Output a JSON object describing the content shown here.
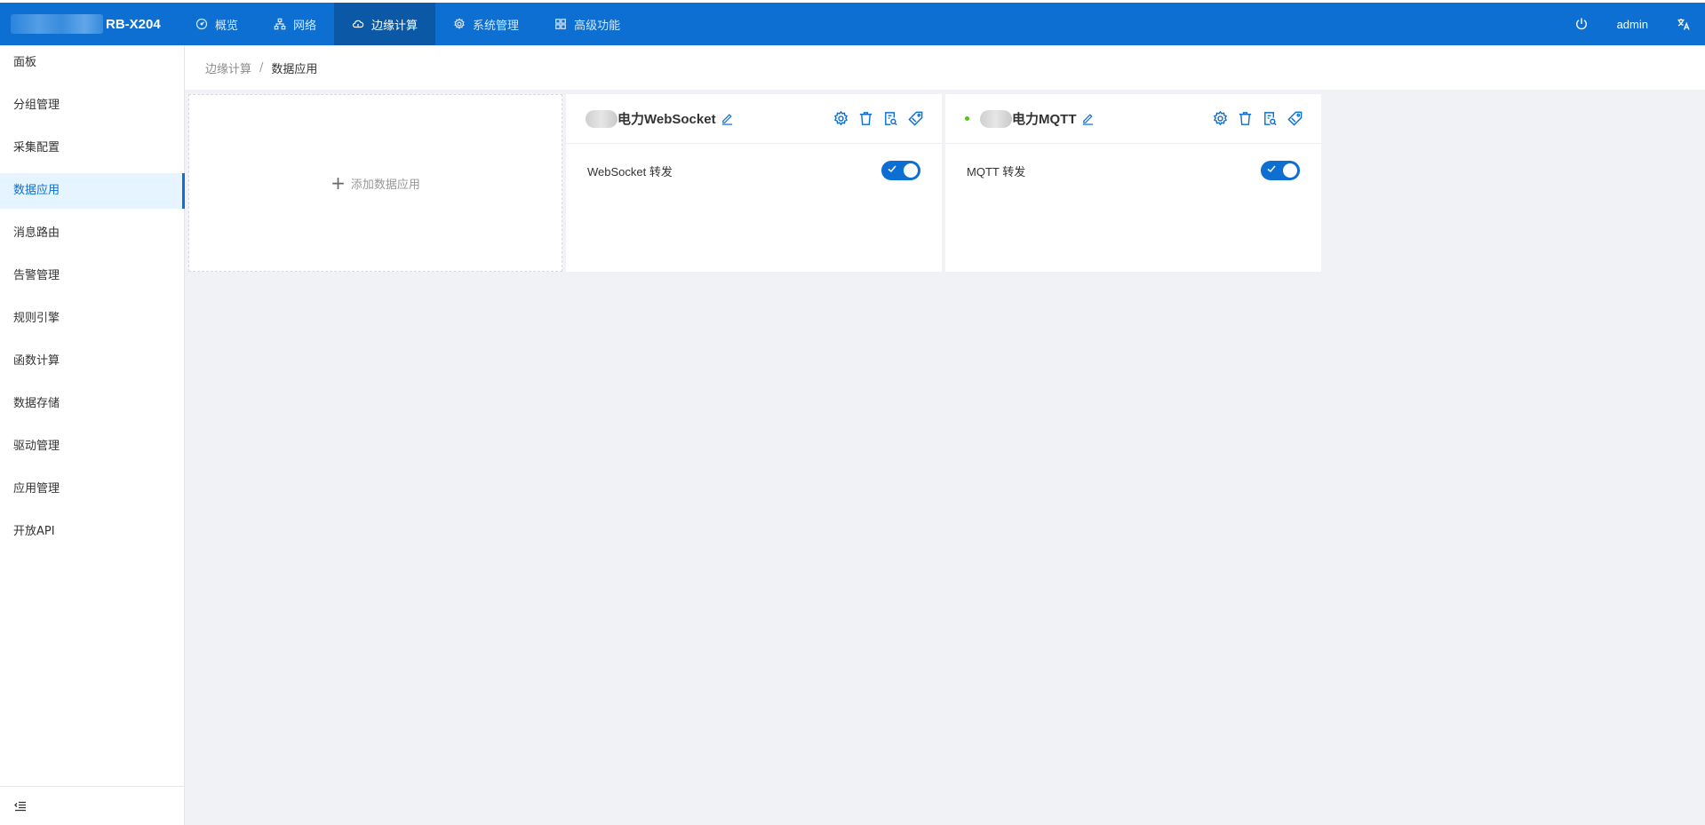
{
  "header": {
    "brand_model": "RB-X204",
    "nav": [
      {
        "label": "概览",
        "icon": "dashboard-icon"
      },
      {
        "label": "网络",
        "icon": "network-icon"
      },
      {
        "label": "边缘计算",
        "icon": "cloud-icon",
        "active": true
      },
      {
        "label": "系统管理",
        "icon": "gear-icon"
      },
      {
        "label": "高级功能",
        "icon": "grid-icon"
      }
    ],
    "user": "admin",
    "power_icon": "power-icon",
    "lang_icon": "translate-icon"
  },
  "sidebar": {
    "items": [
      {
        "label": "面板"
      },
      {
        "label": "分组管理"
      },
      {
        "label": "采集配置"
      },
      {
        "label": "数据应用",
        "active": true
      },
      {
        "label": "消息路由"
      },
      {
        "label": "告警管理"
      },
      {
        "label": "规则引擎"
      },
      {
        "label": "函数计算"
      },
      {
        "label": "数据存储"
      },
      {
        "label": "驱动管理"
      },
      {
        "label": "应用管理"
      },
      {
        "label": "开放API"
      }
    ],
    "footer_icon": "menu-fold-icon"
  },
  "breadcrumb": {
    "parent": "边缘计算",
    "separator": "/",
    "current": "数据应用"
  },
  "add_card": {
    "label": "添加数据应用"
  },
  "apps": [
    {
      "title": "电力WebSocket",
      "status_dot": false,
      "row_label": "WebSocket 转发",
      "enabled": true
    },
    {
      "title": "电力MQTT",
      "status_dot": true,
      "row_label": "MQTT 转发",
      "enabled": true
    }
  ],
  "colors": {
    "primary": "#0c6fd1",
    "active_nav": "#0a58a6",
    "status_green": "#52c41a",
    "background": "#f0f2f5"
  }
}
